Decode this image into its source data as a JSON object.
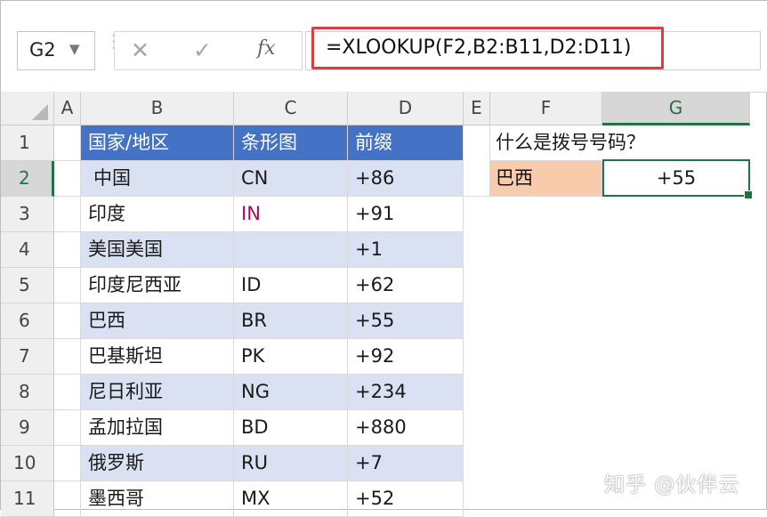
{
  "formula_bar": {
    "name_box": "G2",
    "cancel_symbol": "✕",
    "enter_symbol": "✓",
    "fx_symbol": "fx",
    "formula": "=XLOOKUP(F2,B2:B11,D2:D11)"
  },
  "columns": [
    "A",
    "B",
    "C",
    "D",
    "E",
    "F",
    "G"
  ],
  "rows": [
    "1",
    "2",
    "3",
    "4",
    "5",
    "6",
    "7",
    "8",
    "9",
    "10",
    "11"
  ],
  "table": {
    "headers": [
      "国家/地区",
      "条形图",
      "前缀"
    ],
    "rows": [
      [
        "中国",
        "CN",
        "+86"
      ],
      [
        "印度",
        "IN",
        "+91"
      ],
      [
        "美国美国",
        "",
        "+1"
      ],
      [
        "印度尼西亚",
        "ID",
        "+62"
      ],
      [
        "巴西",
        "BR",
        "+55"
      ],
      [
        "巴基斯坦",
        "PK",
        "+92"
      ],
      [
        "尼日利亚",
        "NG",
        "+234"
      ],
      [
        "孟加拉国",
        "BD",
        "+880"
      ],
      [
        "俄罗斯",
        "RU",
        "+7"
      ],
      [
        "墨西哥",
        "MX",
        "+52"
      ]
    ]
  },
  "lookup": {
    "question": "什么是拨号号码？",
    "input": "巴西",
    "result": "+55"
  },
  "colors": {
    "table_header": "#4472c4",
    "band": "#d9e1f2",
    "input_cell": "#f8cbad",
    "selection": "#217346",
    "formula_highlight": "#e03c3c"
  },
  "watermark": "知乎 @伙伴云"
}
